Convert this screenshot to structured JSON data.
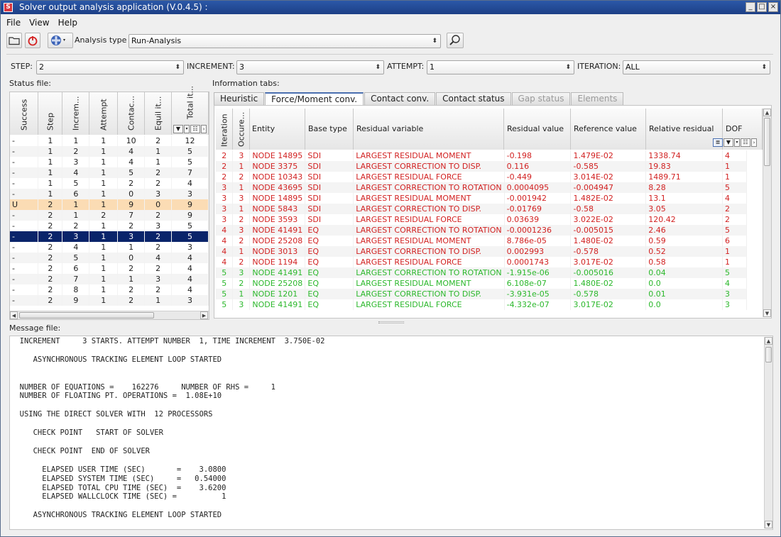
{
  "window": {
    "title": "Solver output analysis application (V.0.4.5) :"
  },
  "menu": [
    "File",
    "View",
    "Help"
  ],
  "toolbar": {
    "analysis_type_label": "Analysis type",
    "analysis_type_value": "Run-Analysis"
  },
  "filters": {
    "step_label": "STEP:",
    "step_value": "2",
    "increment_label": "INCREMENT:",
    "increment_value": "3",
    "attempt_label": "ATTEMPT:",
    "attempt_value": "1",
    "iteration_label": "ITERATION:",
    "iteration_value": "ALL"
  },
  "status": {
    "section_label": "Status file:",
    "headers": [
      "Success",
      "Step",
      "Increm...",
      "Attempt",
      "Contac...",
      "Equil it...",
      "Total it..."
    ],
    "rows": [
      [
        "-",
        "1",
        "1",
        "1",
        "10",
        "2",
        "12"
      ],
      [
        "-",
        "1",
        "2",
        "1",
        "4",
        "1",
        "5"
      ],
      [
        "-",
        "1",
        "3",
        "1",
        "4",
        "1",
        "5"
      ],
      [
        "-",
        "1",
        "4",
        "1",
        "5",
        "2",
        "7"
      ],
      [
        "-",
        "1",
        "5",
        "1",
        "2",
        "2",
        "4"
      ],
      [
        "-",
        "1",
        "6",
        "1",
        "0",
        "3",
        "3"
      ],
      [
        "U",
        "2",
        "1",
        "1",
        "9",
        "0",
        "9"
      ],
      [
        "-",
        "2",
        "1",
        "2",
        "7",
        "2",
        "9"
      ],
      [
        "-",
        "2",
        "2",
        "1",
        "2",
        "3",
        "5"
      ],
      [
        "-",
        "2",
        "3",
        "1",
        "3",
        "2",
        "5"
      ],
      [
        "-",
        "2",
        "4",
        "1",
        "1",
        "2",
        "3"
      ],
      [
        "-",
        "2",
        "5",
        "1",
        "0",
        "4",
        "4"
      ],
      [
        "-",
        "2",
        "6",
        "1",
        "2",
        "2",
        "4"
      ],
      [
        "-",
        "2",
        "7",
        "1",
        "1",
        "3",
        "4"
      ],
      [
        "-",
        "2",
        "8",
        "1",
        "2",
        "2",
        "4"
      ],
      [
        "-",
        "2",
        "9",
        "1",
        "2",
        "1",
        "3"
      ]
    ],
    "highlight_row": 6,
    "selected_row": 9,
    "colors": {
      "highlight": "#fbdcb4",
      "selected": "#0a246a"
    }
  },
  "info": {
    "section_label": "Information tabs:",
    "tabs": [
      "Heuristic",
      "Force/Moment conv.",
      "Contact conv.",
      "Contact status",
      "Gap status",
      "Elements"
    ],
    "active_tab": 1,
    "disabled_tabs": [
      4,
      5
    ],
    "headers": [
      "Iteration",
      "Occure...",
      "Entity",
      "Base type",
      "Residual variable",
      "Residual value",
      "Reference value",
      "Relative residual",
      "DOF"
    ],
    "rows": [
      [
        "2",
        "3",
        "NODE 14895",
        "SDI",
        "LARGEST RESIDUAL MOMENT",
        "-0.198",
        "1.479E-02",
        "1338.74",
        "4",
        "red"
      ],
      [
        "2",
        "1",
        "NODE 3375",
        "SDI",
        "LARGEST CORRECTION TO DISP.",
        "0.116",
        "-0.585",
        "19.83",
        "1",
        "red"
      ],
      [
        "2",
        "2",
        "NODE 10343",
        "SDI",
        "LARGEST RESIDUAL FORCE",
        "-0.449",
        "3.014E-02",
        "1489.71",
        "1",
        "red"
      ],
      [
        "3",
        "1",
        "NODE 43695",
        "SDI",
        "LARGEST CORRECTION TO ROTATION",
        "0.0004095",
        "-0.004947",
        "8.28",
        "5",
        "red"
      ],
      [
        "3",
        "3",
        "NODE 14895",
        "SDI",
        "LARGEST RESIDUAL MOMENT",
        "-0.001942",
        "1.482E-02",
        "13.1",
        "4",
        "red"
      ],
      [
        "3",
        "1",
        "NODE 5843",
        "SDI",
        "LARGEST CORRECTION TO DISP.",
        "-0.01769",
        "-0.58",
        "3.05",
        "2",
        "red"
      ],
      [
        "3",
        "2",
        "NODE 3593",
        "SDI",
        "LARGEST RESIDUAL FORCE",
        "0.03639",
        "3.022E-02",
        "120.42",
        "2",
        "red"
      ],
      [
        "4",
        "3",
        "NODE 41491",
        "EQ",
        "LARGEST CORRECTION TO ROTATION",
        "-0.0001236",
        "-0.005015",
        "2.46",
        "5",
        "red"
      ],
      [
        "4",
        "2",
        "NODE 25208",
        "EQ",
        "LARGEST RESIDUAL MOMENT",
        "8.786e-05",
        "1.480E-02",
        "0.59",
        "6",
        "red"
      ],
      [
        "4",
        "1",
        "NODE 3013",
        "EQ",
        "LARGEST CORRECTION TO DISP.",
        "0.002993",
        "-0.578",
        "0.52",
        "1",
        "red"
      ],
      [
        "4",
        "2",
        "NODE 1194",
        "EQ",
        "LARGEST RESIDUAL FORCE",
        "0.0001743",
        "3.017E-02",
        "0.58",
        "1",
        "red"
      ],
      [
        "5",
        "3",
        "NODE 41491",
        "EQ",
        "LARGEST CORRECTION TO ROTATION",
        "-1.915e-06",
        "-0.005016",
        "0.04",
        "5",
        "green"
      ],
      [
        "5",
        "2",
        "NODE 25208",
        "EQ",
        "LARGEST RESIDUAL MOMENT",
        "6.108e-07",
        "1.480E-02",
        "0.0",
        "4",
        "green"
      ],
      [
        "5",
        "1",
        "NODE 1201",
        "EQ",
        "LARGEST CORRECTION TO DISP.",
        "-3.931e-05",
        "-0.578",
        "0.01",
        "3",
        "green"
      ],
      [
        "5",
        "3",
        "NODE 41491",
        "EQ",
        "LARGEST RESIDUAL FORCE",
        "-4.332e-07",
        "3.017E-02",
        "0.0",
        "3",
        "green"
      ]
    ],
    "colors": {
      "red": "#d22222",
      "green": "#2cb82c"
    }
  },
  "message": {
    "section_label": "Message file:",
    "lines": [
      "  INCREMENT     3 STARTS. ATTEMPT NUMBER  1, TIME INCREMENT  3.750E-02",
      "",
      "     ASYNCHRONOUS TRACKING ELEMENT LOOP STARTED",
      "",
      "",
      "  NUMBER OF EQUATIONS =    162276     NUMBER OF RHS =     1",
      "  NUMBER OF FLOATING PT. OPERATIONS =  1.08E+10",
      "",
      "  USING THE DIRECT SOLVER WITH  12 PROCESSORS",
      "",
      "     CHECK POINT   START OF SOLVER",
      "",
      "     CHECK POINT  END OF SOLVER",
      "",
      "       ELAPSED USER TIME (SEC)       =    3.0800",
      "       ELAPSED SYSTEM TIME (SEC)     =   0.54000",
      "       ELAPSED TOTAL CPU TIME (SEC)  =    3.6200",
      "       ELAPSED WALLCLOCK TIME (SEC) =          1",
      "",
      "     ASYNCHRONOUS TRACKING ELEMENT LOOP STARTED"
    ]
  }
}
